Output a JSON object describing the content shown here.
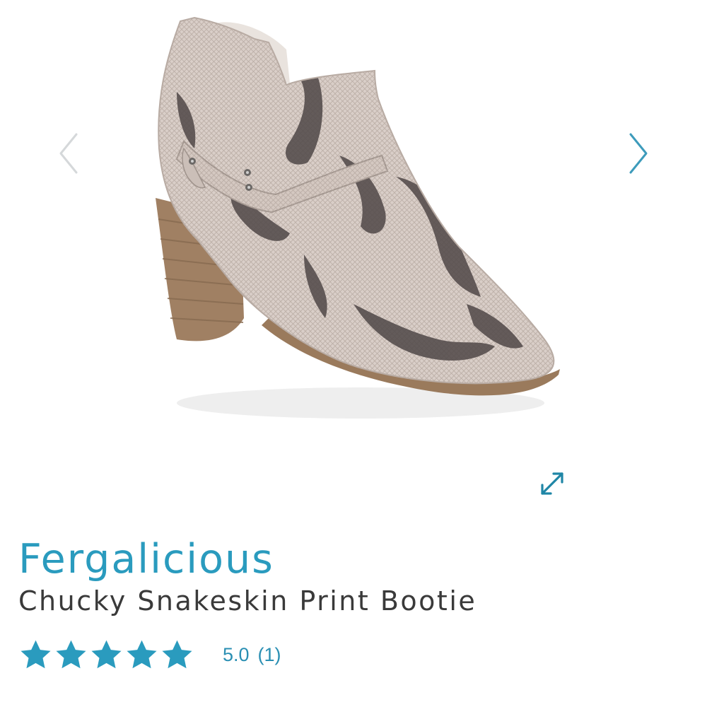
{
  "gallery": {
    "image_alt": "Chucky Snakeskin Print Bootie",
    "prev_icon": "chevron-left-icon",
    "next_icon": "chevron-right-icon",
    "expand_icon": "expand-arrows-icon"
  },
  "product": {
    "brand": "Fergalicious",
    "name": "Chucky Snakeskin Print Bootie"
  },
  "rating": {
    "value": 5.0,
    "max": 5,
    "score_text": "5.0",
    "count_text": "(1)",
    "star_icon": "star-icon"
  },
  "colors": {
    "accent": "#2a9bbe",
    "star": "#2a9bbe",
    "arrow_prev": "#d5d8da",
    "arrow_next": "#3d9bbb",
    "text_dark": "#3a3a3a"
  }
}
